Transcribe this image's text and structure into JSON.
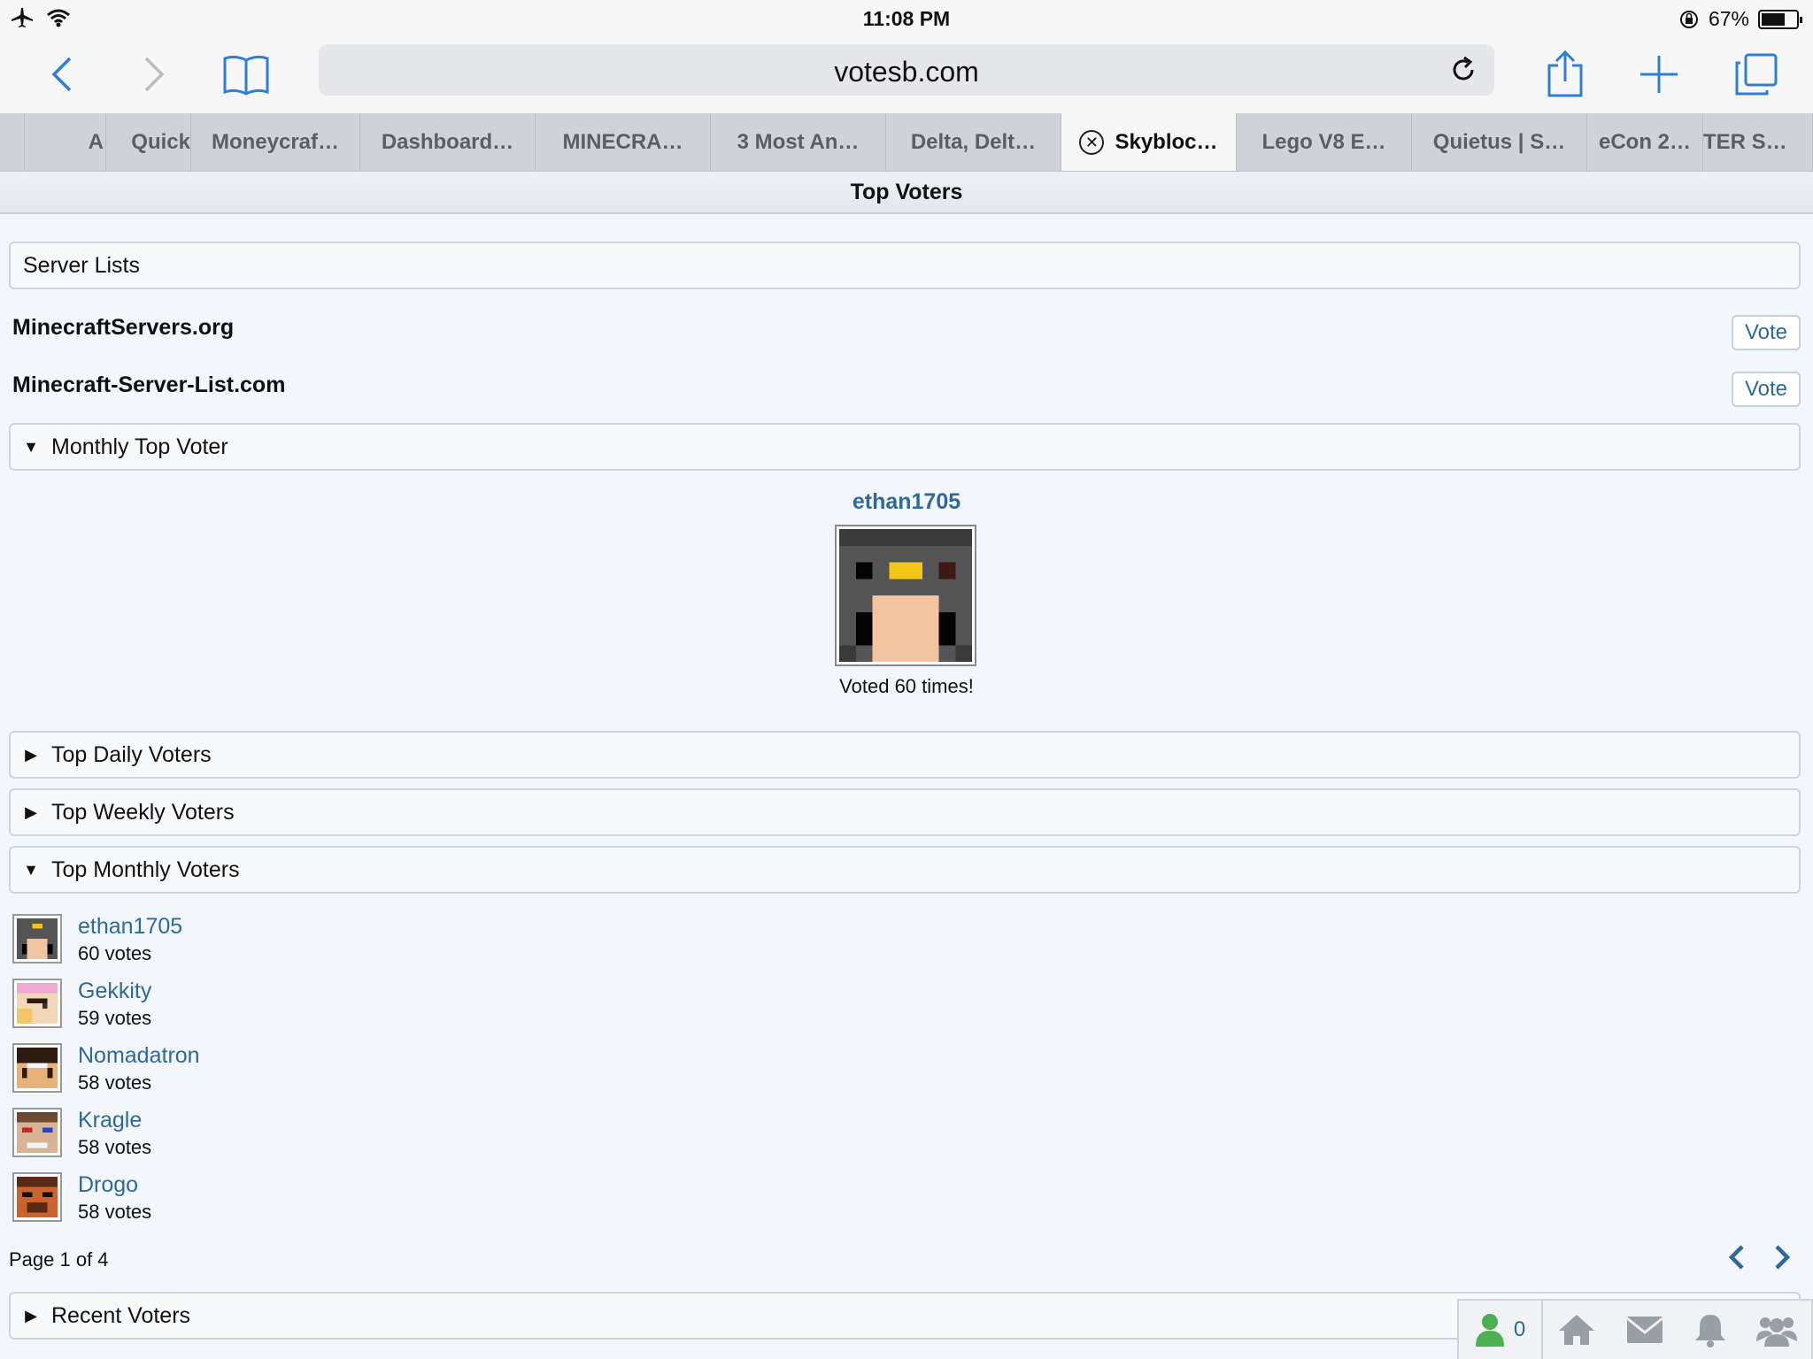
{
  "status_bar": {
    "time": "11:08 PM",
    "battery": "67%"
  },
  "browser": {
    "url": "votesb.com",
    "tabs": [
      {
        "label": "A"
      },
      {
        "label": "Quick"
      },
      {
        "label": "Moneycraf…"
      },
      {
        "label": "Dashboard…"
      },
      {
        "label": "MINECRA…"
      },
      {
        "label": "3 Most An…"
      },
      {
        "label": "Delta, Delt…"
      },
      {
        "label": "Skybloc…"
      },
      {
        "label": "Lego V8 E…"
      },
      {
        "label": "Quietus | S…"
      },
      {
        "label": "eCon 2…"
      },
      {
        "label": "TER S…"
      }
    ]
  },
  "page": {
    "title": "Top Voters",
    "server_lists": {
      "heading": "Server Lists",
      "items": [
        {
          "name": "MinecraftServers.org",
          "button": "Vote"
        },
        {
          "name": "Minecraft-Server-List.com",
          "button": "Vote"
        }
      ]
    },
    "monthly_top_voter": {
      "heading": "Monthly Top Voter",
      "name": "ethan1705",
      "text": "Voted 60 times!"
    },
    "sections": {
      "daily": "Top Daily Voters",
      "weekly": "Top Weekly Voters",
      "monthly": "Top Monthly Voters",
      "recent": "Recent Voters"
    },
    "voters": [
      {
        "name": "ethan1705",
        "votes": "60 votes"
      },
      {
        "name": "Gekkity",
        "votes": "59 votes"
      },
      {
        "name": "Nomadatron",
        "votes": "58 votes"
      },
      {
        "name": "Kragle",
        "votes": "58 votes"
      },
      {
        "name": "Drogo",
        "votes": "58 votes"
      }
    ],
    "pagination": "Page 1 of 4"
  },
  "bottom_bar": {
    "online_count": "0"
  },
  "colors": {
    "link": "#2d6a9a",
    "ios_blue": "#2f7fd7",
    "online_green": "#4caf50"
  }
}
